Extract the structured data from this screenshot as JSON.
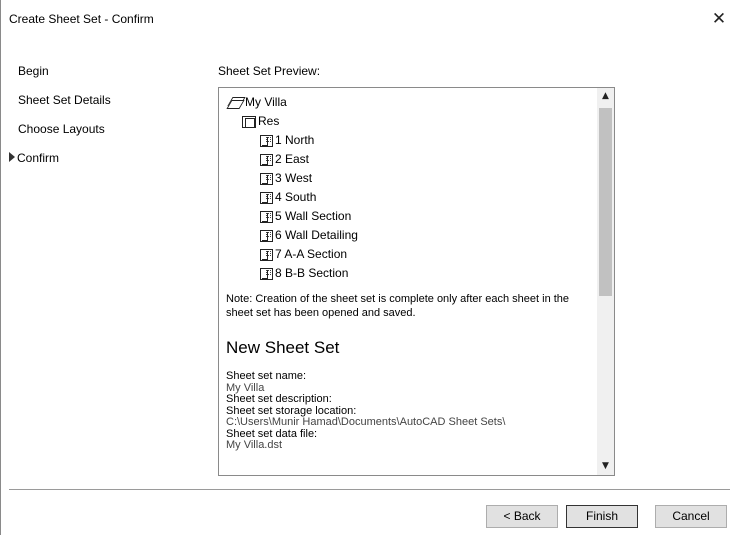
{
  "window": {
    "title": "Create Sheet Set - Confirm",
    "close_glyph": "✕"
  },
  "steps": {
    "items": [
      {
        "label": "Begin",
        "current": false
      },
      {
        "label": "Sheet Set Details",
        "current": false
      },
      {
        "label": "Choose Layouts",
        "current": false
      },
      {
        "label": "Confirm",
        "current": true
      }
    ]
  },
  "preview": {
    "label": "Sheet Set Preview:",
    "tree": {
      "root": {
        "label": "My Villa",
        "icon": "sheet-set-icon"
      },
      "subset": {
        "label": "Res",
        "icon": "subset-icon"
      },
      "sheets": [
        "1 North",
        "2 East",
        "3 West",
        "4 South",
        "5 Wall Section",
        "6 Wall Detailing",
        "7 A-A Section",
        "8 B-B Section"
      ]
    },
    "note": "Note: Creation of the sheet set is complete only after each sheet in the sheet set has been opened and saved.",
    "heading": "New Sheet Set",
    "details": {
      "name_label": "Sheet set name:",
      "name_value": "My Villa",
      "description_label": "Sheet set description:",
      "storage_label": "Sheet set storage location:",
      "storage_value": "C:\\Users\\Munir Hamad\\Documents\\AutoCAD Sheet Sets\\",
      "datafile_label": "Sheet set data file:",
      "datafile_value": "My Villa.dst"
    },
    "scroll_up_glyph": "▲",
    "scroll_down_glyph": "▼"
  },
  "buttons": {
    "back": "< Back",
    "finish": "Finish",
    "cancel": "Cancel"
  }
}
